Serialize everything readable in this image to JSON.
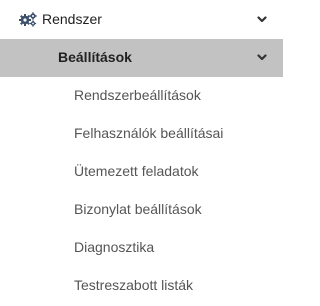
{
  "menu": {
    "top": {
      "label": "Rendszer",
      "icon": "cogs-icon"
    },
    "submenu": {
      "label": "Beállítások",
      "icon": "chevron-down-icon"
    },
    "items": [
      {
        "label": "Rendszerbeállítások"
      },
      {
        "label": "Felhasználók beállításai"
      },
      {
        "label": "Ütemezett feladatok"
      },
      {
        "label": "Bizonylat beállítások"
      },
      {
        "label": "Diagnosztika"
      },
      {
        "label": "Testreszabott listák"
      }
    ]
  },
  "colors": {
    "active_background": "#c2c2c2",
    "icon": "#3c4f6b",
    "text": "#222222",
    "leaf_text": "#555555"
  }
}
